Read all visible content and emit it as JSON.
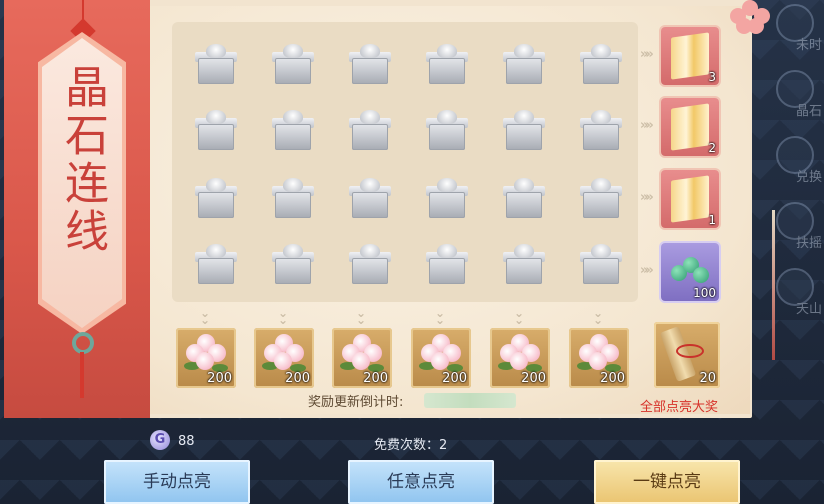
{
  "banner": {
    "title": "晶石连线"
  },
  "side_nav": [
    {
      "label": "未时",
      "icon": "clock-icon"
    },
    {
      "label": "晶石",
      "icon": "crystal-icon"
    },
    {
      "label": "兑换",
      "icon": "exchange-icon"
    },
    {
      "label": "扶摇",
      "icon": "wind-icon"
    },
    {
      "label": "天山",
      "icon": "mountain-icon"
    }
  ],
  "grid": {
    "rows": 4,
    "cols": 6,
    "cell_item": "silver-gift-box"
  },
  "row_rewards": [
    {
      "count": "3",
      "item": "golden-scroll"
    },
    {
      "count": "2",
      "item": "golden-scroll"
    },
    {
      "count": "1",
      "item": "golden-scroll"
    },
    {
      "count": "100",
      "item": "jade-pills"
    }
  ],
  "column_rewards": [
    {
      "count": "200",
      "item": "camellia-flower"
    },
    {
      "count": "200",
      "item": "camellia-flower"
    },
    {
      "count": "200",
      "item": "camellia-flower"
    },
    {
      "count": "200",
      "item": "camellia-flower"
    },
    {
      "count": "200",
      "item": "camellia-flower"
    },
    {
      "count": "200",
      "item": "camellia-flower"
    }
  ],
  "grand_prize": {
    "count": "20",
    "label": "全部点亮大奖",
    "item": "scroll-with-ribbon"
  },
  "countdown": {
    "label": "奖励更新倒计时:"
  },
  "currency": {
    "value": "88",
    "icon": "crystal-currency-icon"
  },
  "free_tries": {
    "label": "免费次数：2"
  },
  "buttons": {
    "manual": "手动点亮",
    "any": "任意点亮",
    "one_click": "一键点亮"
  },
  "colors": {
    "banner_red": "#d9574a",
    "button_blue": "#8fc4ef",
    "button_gold": "#eac470",
    "grand_label_red": "#d7322a"
  }
}
